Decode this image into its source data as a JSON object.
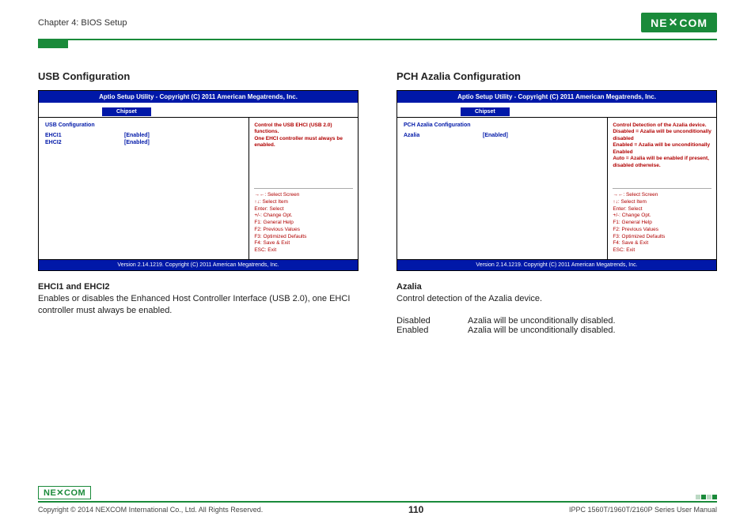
{
  "header": {
    "chapter": "Chapter 4: BIOS Setup",
    "logo": "NEXCOM"
  },
  "left": {
    "title": "USB Configuration",
    "bios": {
      "title": "Aptio Setup Utility - Copyright (C) 2011 American Megatrends, Inc.",
      "tab": "Chipset",
      "heading": "USB Configuration",
      "rows": [
        {
          "label": "EHCI1",
          "value": "[Enabled]"
        },
        {
          "label": "EHCI2",
          "value": "[Enabled]"
        }
      ],
      "infoTop": "Control the USB EHCI (USB 2.0) functions.\nOne EHCI controller must always be enabled.",
      "help": "→←: Select Screen\n↑↓: Select Item\nEnter: Select\n+/-: Change Opt.\nF1: General Help\nF2: Previous Values\nF3: Optimized Defaults\nF4: Save & Exit\nESC: Exit",
      "footer": "Version 2.14.1219. Copyright (C) 2011 American Megatrends, Inc."
    },
    "descHeading": "EHCI1 and EHCI2",
    "descText": "Enables or disables the Enhanced Host Controller Interface (USB 2.0), one EHCI controller must always be enabled."
  },
  "right": {
    "title": "PCH Azalia Configuration",
    "bios": {
      "title": "Aptio Setup Utility - Copyright (C) 2011 American Megatrends, Inc.",
      "tab": "Chipset",
      "heading": "PCH Azalia Configuration",
      "rows": [
        {
          "label": "Azalia",
          "value": "[Enabled]"
        }
      ],
      "infoTop": "Control Detection of the Azalia device.\nDisabled = Azalia will be unconditionally disabled\nEnabled = Azalia will be unconditionally Enabled\nAuto = Azalia will be enabled if present, disabled otherwise.",
      "help": "→←: Select Screen\n↑↓: Select Item\nEnter: Select\n+/-: Change Opt.\nF1: General Help\nF2: Previous Values\nF3: Optimized Defaults\nF4: Save & Exit\nESC: Exit",
      "footer": "Version 2.14.1219. Copyright (C) 2011 American Megatrends, Inc."
    },
    "descHeading": "Azalia",
    "descText": "Control detection of the Azalia device.",
    "table": [
      {
        "k": "Disabled",
        "v": "Azalia will be unconditionally disabled."
      },
      {
        "k": "Enabled",
        "v": "Azalia will be unconditionally disabled."
      }
    ]
  },
  "footer": {
    "logo": "NEXCOM",
    "copyright": "Copyright © 2014 NEXCOM International Co., Ltd. All Rights Reserved.",
    "page": "110",
    "manual": "IPPC 1560T/1960T/2160P Series User Manual"
  }
}
